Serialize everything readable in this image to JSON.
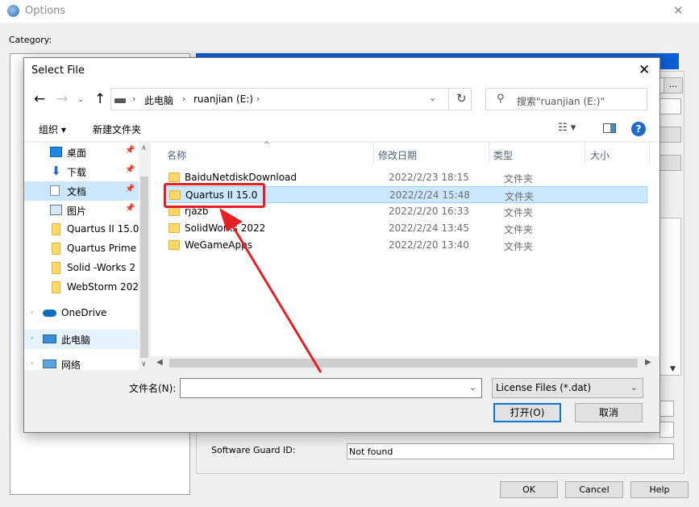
{
  "options_window": {
    "title": "Options",
    "category_label": "Category:",
    "browse_label": "...",
    "software_guard_label": "Software Guard ID:",
    "software_guard_value": "Not found",
    "buttons": {
      "ok": "OK",
      "cancel": "Cancel",
      "help": "Help"
    }
  },
  "dialog": {
    "title": "Select File",
    "close_label": "✕",
    "address": {
      "crumbs": [
        "此电脑",
        "ruanjian (E:)"
      ]
    },
    "search_placeholder": "搜索\"ruanjian (E:)\"",
    "toolbar": {
      "organize_label": "组织 ▾",
      "new_folder_label": "新建文件夹"
    },
    "nav_items": [
      {
        "label": "桌面",
        "icon": "desktop-icon",
        "pinned": true
      },
      {
        "label": "下载",
        "icon": "download-icon",
        "pinned": true
      },
      {
        "label": "文档",
        "icon": "document-icon",
        "pinned": true,
        "selected": true
      },
      {
        "label": "图片",
        "icon": "picture-icon",
        "pinned": true
      },
      {
        "label": "Quartus II 15.0",
        "icon": "folder-icon"
      },
      {
        "label": "Quartus Prime",
        "icon": "folder-icon"
      },
      {
        "label": "Solid -Works 2",
        "icon": "folder-icon"
      },
      {
        "label": "WebStorm 202",
        "icon": "folder-icon"
      },
      {
        "label": "OneDrive",
        "icon": "cloud-icon"
      },
      {
        "label": "此电脑",
        "icon": "computer-icon",
        "hover": true
      },
      {
        "label": "网络",
        "icon": "network-icon"
      }
    ],
    "columns": {
      "name": "名称",
      "modified": "修改日期",
      "type": "类型",
      "size": "大小"
    },
    "files": [
      {
        "name": "BaiduNetdiskDownload",
        "modified": "2022/2/23 18:15",
        "type": "文件夹"
      },
      {
        "name": "Quartus II 15.0",
        "modified": "2022/2/24 15:48",
        "type": "文件夹",
        "selected": true
      },
      {
        "name": "rjazb",
        "modified": "2022/2/20 16:33",
        "type": "文件夹"
      },
      {
        "name": "SolidWorks 2022",
        "modified": "2022/2/24 13:45",
        "type": "文件夹"
      },
      {
        "name": "WeGameApps",
        "modified": "2022/2/20 13:40",
        "type": "文件夹"
      }
    ],
    "filename_label": "文件名(N):",
    "filename_value": "",
    "filetype_value": "License Files (*.dat)",
    "open_label": "打开(O)",
    "cancel_label": "取消"
  },
  "colors": {
    "annotation": "#e42025",
    "selection": "#cce8ff",
    "accent": "#0078d7"
  }
}
